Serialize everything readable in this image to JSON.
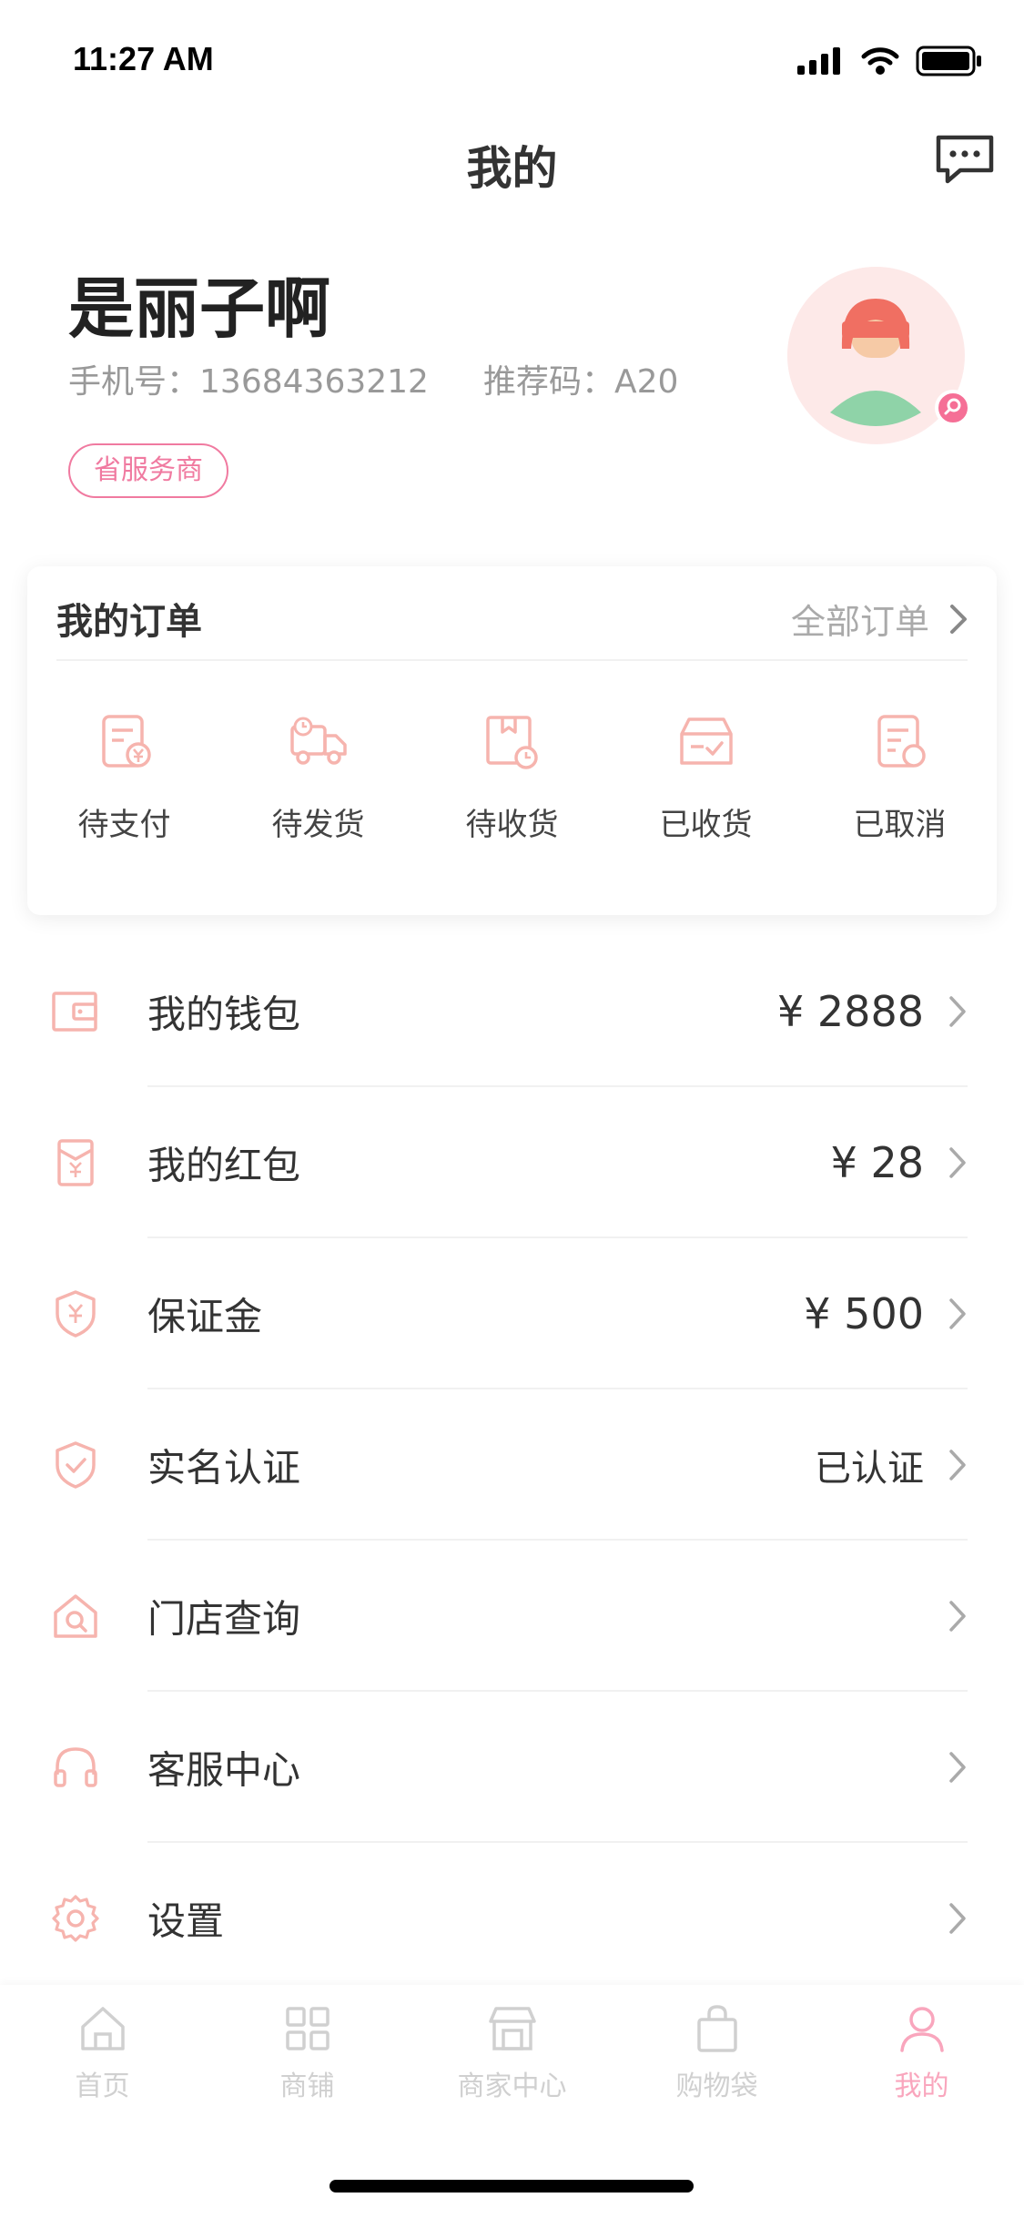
{
  "status_bar": {
    "time": "11:27 AM"
  },
  "nav": {
    "title": "我的"
  },
  "profile": {
    "name": "是丽子啊",
    "phone_label": "手机号：",
    "phone": "13684363212",
    "referral_label": "推荐码：",
    "referral_code": "A20",
    "level_badge": "省服务商"
  },
  "orders": {
    "title": "我的订单",
    "all_label": "全部订单",
    "items": [
      {
        "label": "待支付",
        "icon": "pending-payment-icon"
      },
      {
        "label": "待发货",
        "icon": "truck-icon"
      },
      {
        "label": "待收货",
        "icon": "package-clock-icon"
      },
      {
        "label": "已收货",
        "icon": "received-box-icon"
      },
      {
        "label": "已取消",
        "icon": "cancelled-doc-icon"
      }
    ]
  },
  "menu": [
    {
      "label": "我的钱包",
      "value": "¥ 2888",
      "icon": "wallet-icon"
    },
    {
      "label": "我的红包",
      "value": "¥ 28",
      "icon": "red-envelope-icon"
    },
    {
      "label": "保证金",
      "value": "¥ 500",
      "icon": "shield-yen-icon"
    },
    {
      "label": "实名认证",
      "value": "已认证",
      "icon": "shield-check-icon"
    },
    {
      "label": "门店查询",
      "value": "",
      "icon": "store-search-icon"
    },
    {
      "label": "客服中心",
      "value": "",
      "icon": "headset-icon"
    },
    {
      "label": "设置",
      "value": "",
      "icon": "gear-icon"
    }
  ],
  "tabs": [
    {
      "label": "首页",
      "icon": "home-icon",
      "active": false
    },
    {
      "label": "商铺",
      "icon": "grid-icon",
      "active": false
    },
    {
      "label": "商家中心",
      "icon": "shop-icon",
      "active": false
    },
    {
      "label": "购物袋",
      "icon": "bag-icon",
      "active": false
    },
    {
      "label": "我的",
      "icon": "person-icon",
      "active": true
    }
  ],
  "colors": {
    "accent_pink": "#f07aa0",
    "icon_pink": "#f6b4ae",
    "text_primary": "#333333",
    "text_secondary": "#999999",
    "tab_inactive": "#d0d0d0"
  }
}
